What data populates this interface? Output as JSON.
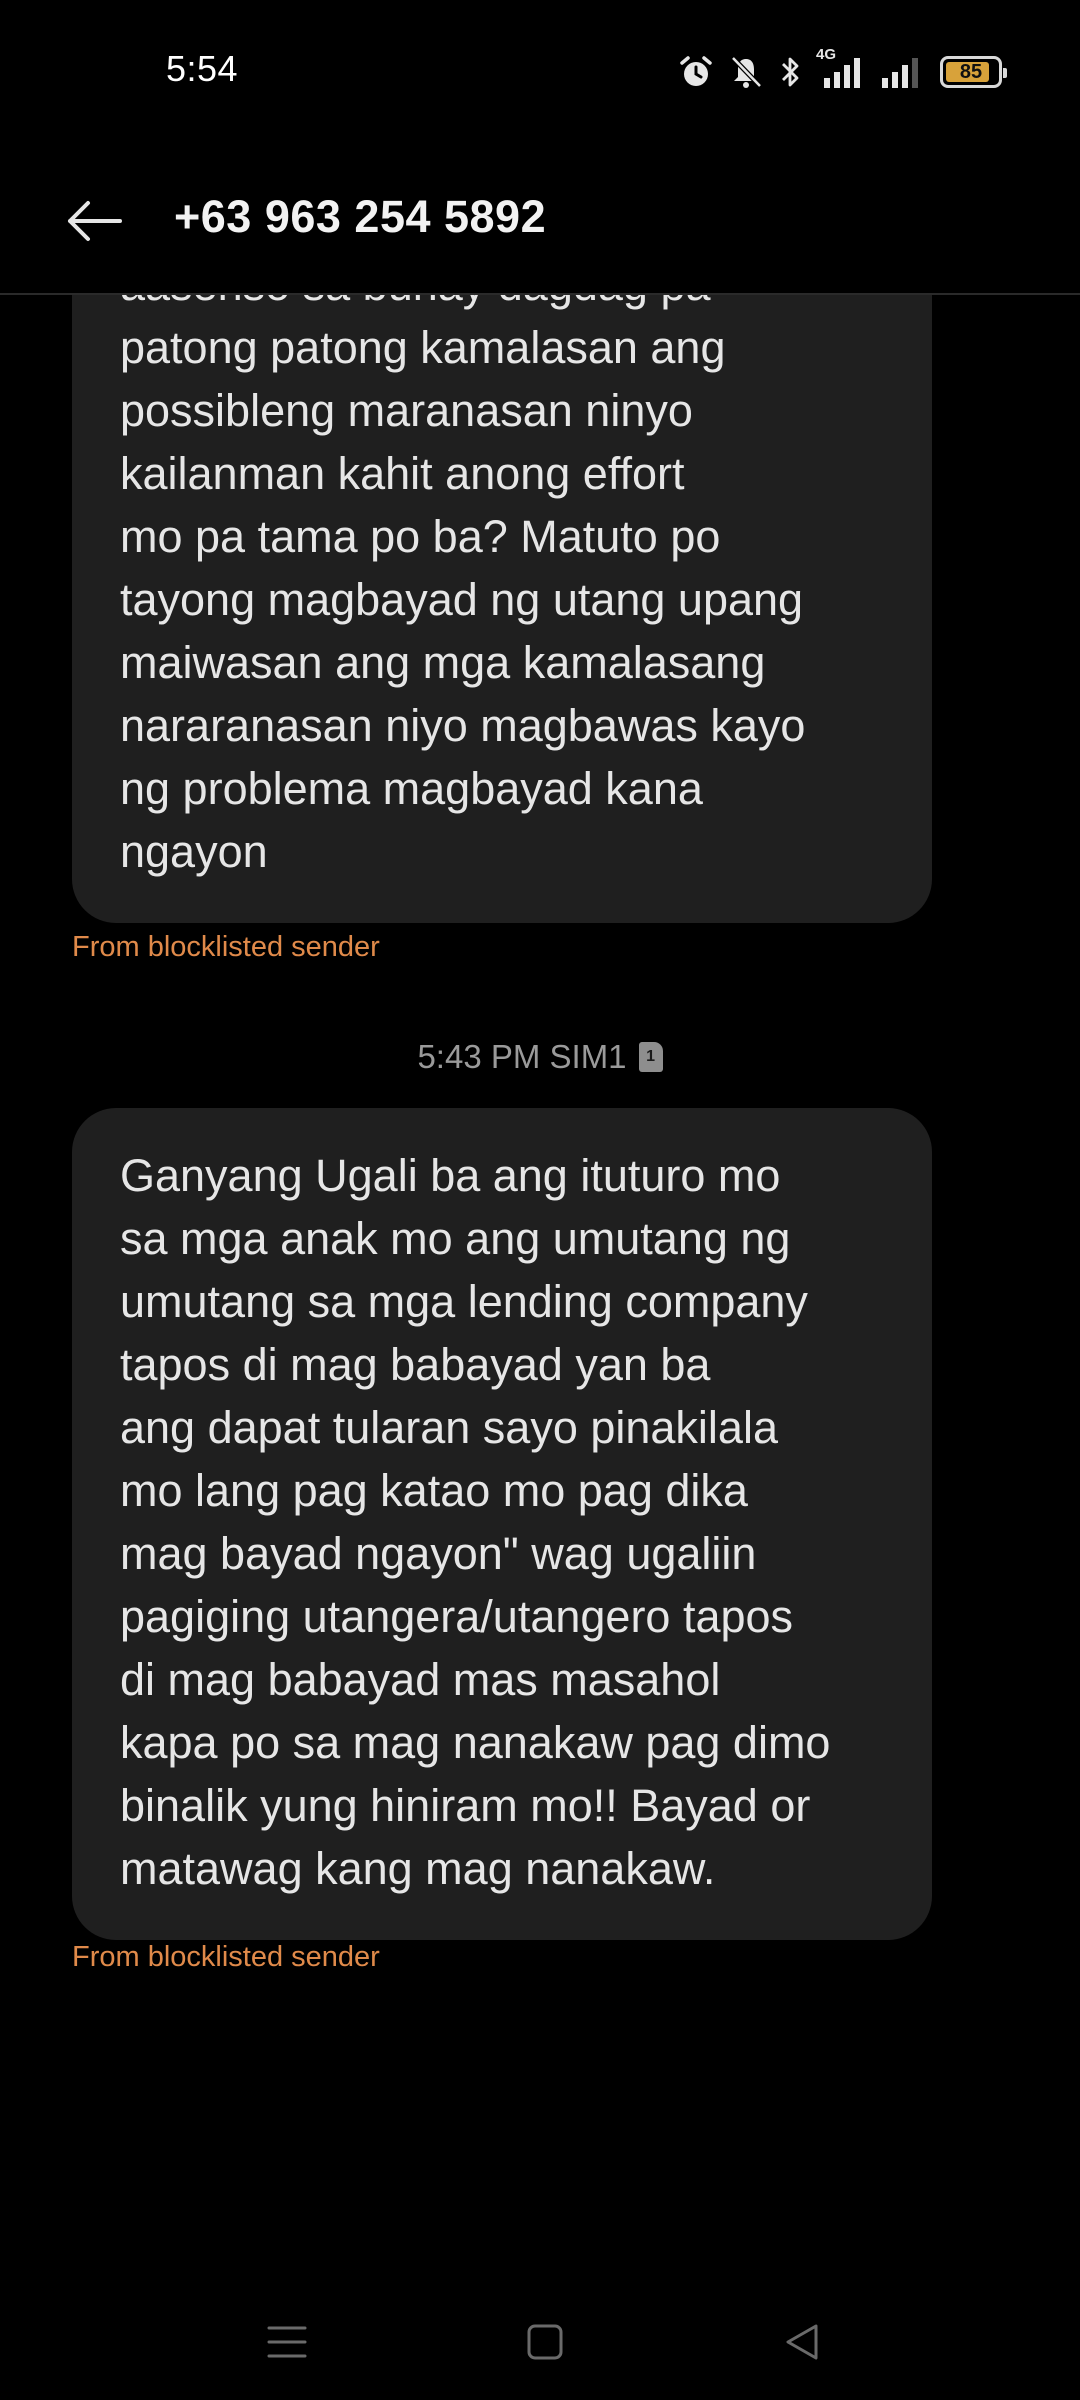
{
  "status_bar": {
    "time": "5:54",
    "network_label": "4G",
    "battery_level": "85",
    "battery_fraction": 0.85,
    "accent_color": "#d8a23a",
    "icons": [
      "alarm-icon",
      "mute-icon",
      "bluetooth-icon",
      "signal-sim1-icon",
      "signal-sim2-icon",
      "battery-icon"
    ]
  },
  "header": {
    "back_icon": "arrow-left-icon",
    "title": "+63 963 254 5892"
  },
  "messages": [
    {
      "text": "aasenso sa buhay dagdag pa\npatong patong kamalasan  ang\npossibleng maranasan ninyo\nkailanman kahit anong effort\nmo pa tama po ba? Matuto po\ntayong magbayad ng utang upang\nmaiwasan ang mga kamalasang\nnararanasan niyo magbawas kayo\nng problema magbayad kana\nngayon",
      "note": "From blocklisted sender"
    },
    {
      "timestamp": "5:43 PM SIM1",
      "sim_number": "1",
      "text": "Ganyang Ugali ba ang ituturo mo\nsa mga anak mo ang umutang ng\numutang sa mga lending company\ntapos di mag babayad yan ba\nang dapat tularan sayo pinakilala\nmo lang pag katao mo pag dika\nmag bayad ngayon\" wag ugaliin\npagiging utangera/utangero tapos\ndi mag babayad mas masahol\nkapa po sa mag nanakaw pag dimo\nbinalik yung hiniram mo!! Bayad or\nmatawag kang mag nanakaw.",
      "note": "From blocklisted sender"
    }
  ],
  "colors": {
    "background": "#000000",
    "bubble": "#1f1f1f",
    "note": "#e08a4a"
  },
  "nav_bar": {
    "icons": [
      "menu-icon",
      "home-square-icon",
      "back-triangle-icon"
    ]
  }
}
